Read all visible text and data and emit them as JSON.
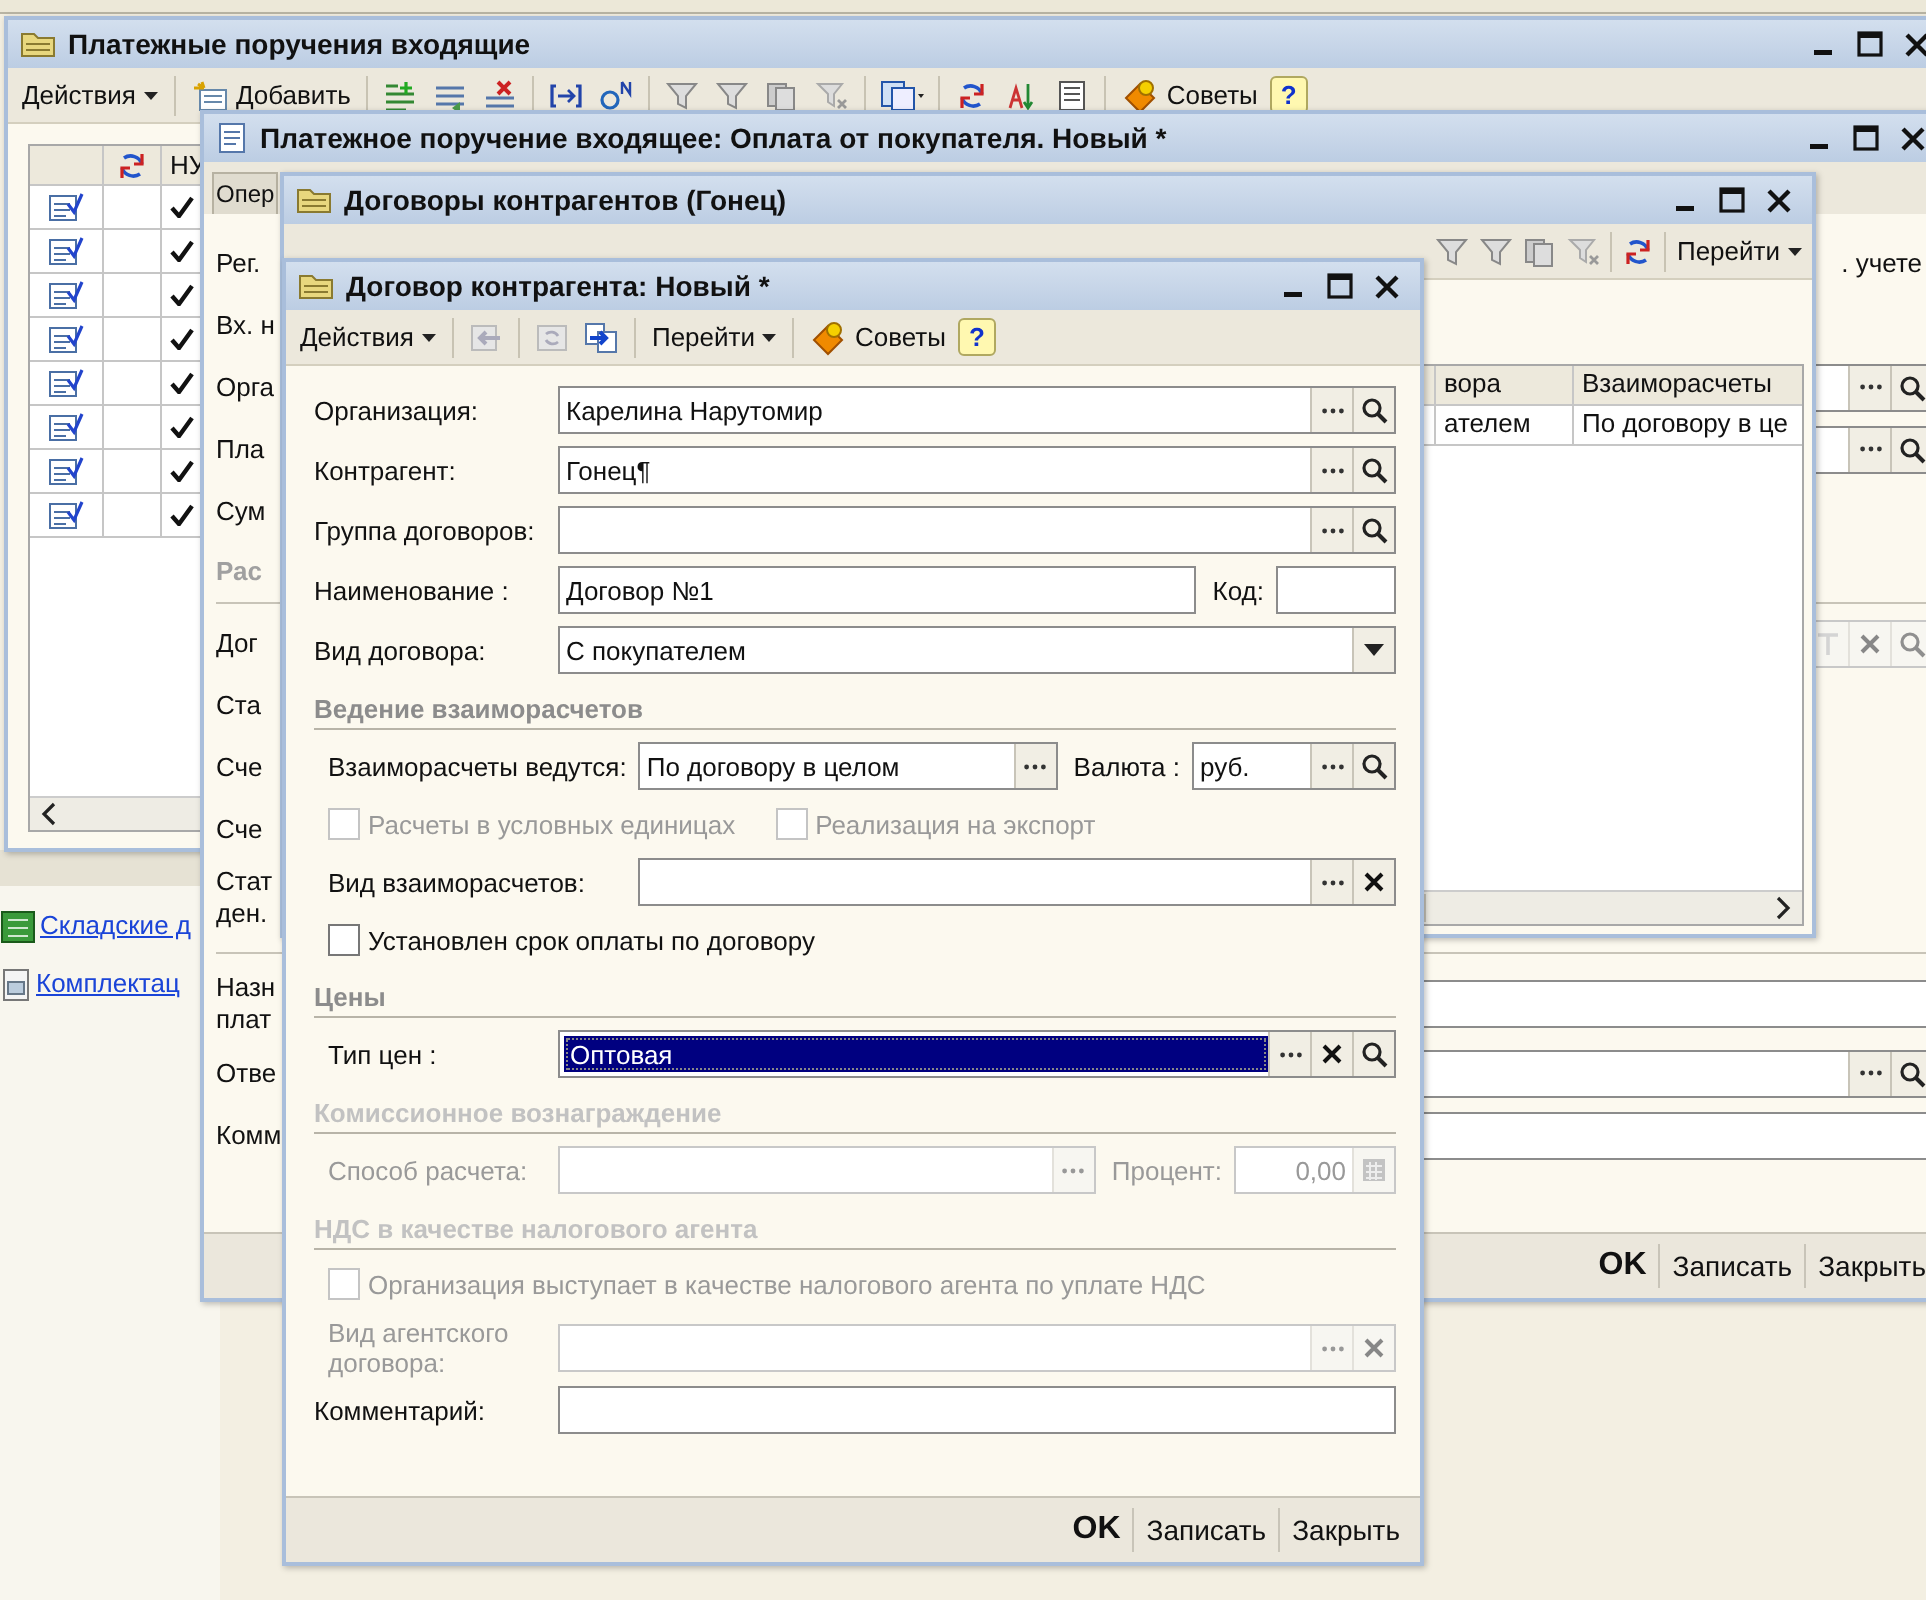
{
  "main_window": {
    "title": "Платежные поручения входящие",
    "toolbar": {
      "actions": "Действия",
      "add": "Добавить",
      "tips": "Советы",
      "help": "?"
    },
    "columns": [
      {
        "kind": "blank"
      },
      {
        "kind": "icon"
      },
      {
        "kind": "text",
        "label": "НУ"
      }
    ],
    "rows": [
      {
        "checked": true
      },
      {
        "checked": true
      },
      {
        "checked": true
      },
      {
        "checked": true
      },
      {
        "checked": true
      },
      {
        "checked": true
      },
      {
        "checked": true
      },
      {
        "checked": true
      }
    ]
  },
  "journals": {
    "links": [
      "Складские д",
      "Комплектац"
    ]
  },
  "payment_window": {
    "title": "Платежное поручение входящее: Оплата от покупателя. Новый *",
    "tab": "Опер",
    "rows": [
      {
        "kind": "text",
        "label": "Рег.",
        "note": ". учете"
      },
      {
        "kind": "text",
        "label": "Вх. н"
      },
      {
        "kind": "lookup",
        "label": "Орга",
        "disabled": false
      },
      {
        "kind": "lookup",
        "label": "Пла",
        "disabled": false
      },
      {
        "kind": "text",
        "label": "Сум"
      },
      {
        "kind": "section",
        "label": "Рас"
      },
      {
        "kind": "filter",
        "label": "Дог",
        "disabled": true
      },
      {
        "kind": "text",
        "label": "Ста"
      },
      {
        "kind": "text",
        "label": "Сче"
      },
      {
        "kind": "text",
        "label": "Сче"
      },
      {
        "kind": "text",
        "label": "Стат ден."
      },
      {
        "kind": "divider"
      },
      {
        "kind": "input",
        "label": "Назн плат",
        "disabled": false
      },
      {
        "kind": "lookup",
        "label": "Отве",
        "disabled": false
      },
      {
        "kind": "input",
        "label": "Комм",
        "disabled": false
      }
    ],
    "buttons": [
      {
        "label": "OK",
        "default": true
      },
      {
        "label": "Записать",
        "default": false
      },
      {
        "label": "Закрыть",
        "default": false
      }
    ]
  },
  "contracts_window": {
    "title": "Договоры контрагентов (Гонец)",
    "toolbar": {
      "goto": "Перейти"
    },
    "columns": [
      "вора",
      "Взаиморасчеты"
    ],
    "rows": [
      [
        "ателем",
        "По договору в це"
      ]
    ]
  },
  "contract_form": {
    "title": "Договор контрагента: Новый *",
    "toolbar": {
      "actions": "Действия",
      "goto": "Перейти",
      "tips": "Советы",
      "help": "?"
    },
    "sections": [
      {
        "kind": "plain",
        "rows": [
          {
            "kind": "field",
            "fields": [
              {
                "kind": "lookup",
                "label": "Организация:",
                "value": "Карелина Нарутомир",
                "focused": false
              }
            ]
          },
          {
            "kind": "field",
            "fields": [
              {
                "kind": "lookup",
                "label": "Контрагент:",
                "value": "Гонец¶",
                "focused": false
              }
            ]
          },
          {
            "kind": "field",
            "fields": [
              {
                "kind": "lookup",
                "label": "Группа договоров:",
                "focused": false
              }
            ]
          },
          {
            "kind": "field",
            "fields": [
              {
                "kind": "plain",
                "label": "Наименование :",
                "value": "Договор №1",
                "focused": false
              },
              {
                "kind": "plain",
                "label": "Код:",
                "focused": false
              }
            ]
          },
          {
            "kind": "field",
            "fields": [
              {
                "kind": "list",
                "label": "Вид договора:",
                "value": "С покупателем",
                "focused": false
              }
            ]
          }
        ]
      },
      {
        "kind": "wide",
        "heading": "Ведение взаиморасчетов",
        "disabled": false,
        "rows": [
          {
            "kind": "field",
            "fields": [
              {
                "kind": "select",
                "label": "Взаиморасчеты ведутся:",
                "value": "По договору в целом",
                "focused": false
              },
              {
                "kind": "lookup",
                "label": "Валюта :",
                "value": "руб.",
                "focused": false
              }
            ]
          },
          {
            "kind": "checkbox",
            "boxes": [
              {
                "label": "Расчеты в условных единицах",
                "checked": false,
                "disabled": true
              },
              {
                "label": "Реализация на экспорт",
                "checked": false,
                "disabled": true
              }
            ]
          },
          {
            "kind": "field",
            "fields": [
              {
                "kind": "clearable",
                "label": "Вид взаиморасчетов:",
                "focused": false
              }
            ]
          },
          {
            "kind": "checkbox",
            "boxes": [
              {
                "label": "Установлен срок оплаты по договору",
                "checked": false,
                "disabled": false
              }
            ]
          }
        ]
      },
      {
        "kind": "plain",
        "heading": "Цены",
        "disabled": false,
        "rows": [
          {
            "kind": "field",
            "fields": [
              {
                "kind": "full",
                "label": "Тип цен :",
                "value": "Оптовая",
                "focused": true
              }
            ]
          }
        ]
      },
      {
        "kind": "plain",
        "heading": "Комиссионное вознаграждение",
        "disabled": true,
        "rows": [
          {
            "kind": "field",
            "fields": [
              {
                "kind": "select",
                "label": "Способ расчета:",
                "focused": false
              },
              {
                "kind": "number",
                "label": "Процент:",
                "value": "0,00",
                "focused": false
              }
            ]
          }
        ]
      },
      {
        "kind": "plain",
        "heading": "НДС в качестве налогового агента",
        "disabled": true,
        "rows": [
          {
            "kind": "checkbox",
            "boxes": [
              {
                "label": "Организация выступает в качестве налогового агента по уплате НДС",
                "checked": false,
                "disabled": true
              }
            ]
          },
          {
            "kind": "field",
            "fields": [
              {
                "kind": "clearable",
                "label": "Вид агентского договора:",
                "focused": false
              }
            ]
          }
        ]
      },
      {
        "kind": "plain",
        "rows": [
          {
            "kind": "field",
            "fields": [
              {
                "kind": "plain",
                "label": "Комментарий:",
                "focused": false
              }
            ]
          }
        ]
      }
    ],
    "buttons": [
      {
        "label": "OK",
        "default": true
      },
      {
        "label": "Записать",
        "default": false
      },
      {
        "label": "Закрыть",
        "default": false
      }
    ]
  }
}
